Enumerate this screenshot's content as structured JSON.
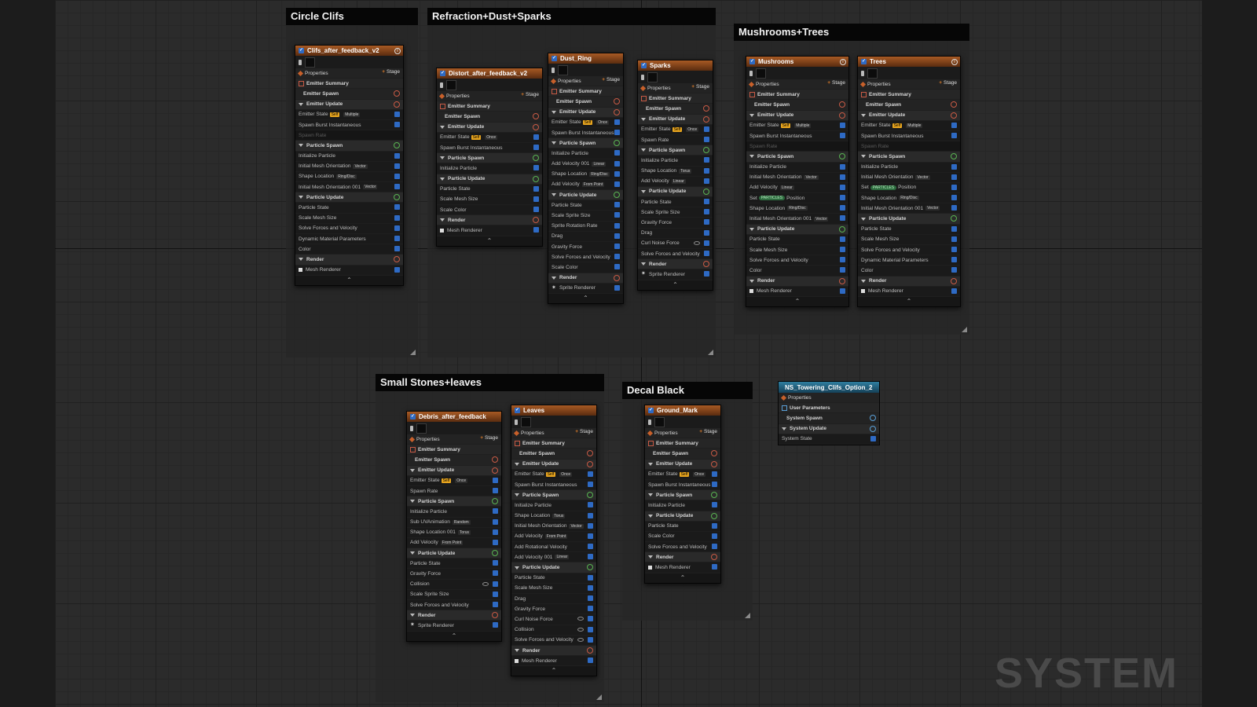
{
  "comments": [
    {
      "id": "c1",
      "title": "Circle Clifs"
    },
    {
      "id": "c2",
      "title": "Refraction+Dust+Sparks"
    },
    {
      "id": "c3",
      "title": "Mushrooms+Trees"
    },
    {
      "id": "c4",
      "title": "Small Stones+leaves"
    },
    {
      "id": "c5",
      "title": "Decal Black"
    }
  ],
  "emitters": [
    {
      "id": "clifs",
      "title": "Clifs_after_feedback_v2",
      "info": true,
      "rows": [
        [
          "props",
          "Properties",
          "Stage"
        ],
        [
          "summary",
          "Emitter Summary"
        ],
        [
          "spawnhdr",
          "Emitter Spawn",
          "plus"
        ],
        [
          "group",
          "Emitter Update",
          "plus"
        ],
        [
          "mod",
          "Emitter State",
          "check",
          "Self",
          "Multiple"
        ],
        [
          "mod",
          "Spawn Burst Instantaneous",
          "check"
        ],
        [
          "dim",
          "Spawn Rate"
        ],
        [
          "group",
          "Particle Spawn",
          "plusg"
        ],
        [
          "mod",
          "Initialize Particle",
          "check"
        ],
        [
          "mod",
          "Initial Mesh Orientation",
          "check",
          "",
          "Vector"
        ],
        [
          "mod",
          "Shape Location",
          "check",
          "",
          "Ring/Disc"
        ],
        [
          "mod",
          "Initial Mesh Orientation 001",
          "check",
          "",
          "Vector"
        ],
        [
          "group",
          "Particle Update",
          "plusg"
        ],
        [
          "mod",
          "Particle State",
          "check"
        ],
        [
          "mod",
          "Scale Mesh Size",
          "check"
        ],
        [
          "mod",
          "Solve Forces and Velocity",
          "check"
        ],
        [
          "mod",
          "Dynamic Material Parameters",
          "check"
        ],
        [
          "mod",
          "Color",
          "check"
        ],
        [
          "group",
          "Render",
          "plus"
        ],
        [
          "mesh",
          "Mesh Renderer",
          "check"
        ]
      ]
    },
    {
      "id": "distort",
      "title": "Distort_after_feedback_v2",
      "rows": [
        [
          "props",
          "Properties",
          "Stage"
        ],
        [
          "summary",
          "Emitter Summary"
        ],
        [
          "spawnhdr",
          "Emitter Spawn",
          "plus"
        ],
        [
          "group",
          "Emitter Update",
          "plus"
        ],
        [
          "mod",
          "Emitter State",
          "check",
          "Self",
          "Once"
        ],
        [
          "mod",
          "Spawn Burst Instantaneous",
          "check"
        ],
        [
          "group",
          "Particle Spawn",
          "plusg"
        ],
        [
          "mod",
          "Initialize Particle",
          "check"
        ],
        [
          "group",
          "Particle Update",
          "plusg"
        ],
        [
          "mod",
          "Particle State",
          "check"
        ],
        [
          "mod",
          "Scale Mesh Size",
          "check"
        ],
        [
          "mod",
          "Scale Color",
          "check"
        ],
        [
          "group",
          "Render",
          "plus"
        ],
        [
          "mesh",
          "Mesh Renderer",
          "check"
        ]
      ]
    },
    {
      "id": "dustring",
      "title": "Dust_Ring",
      "rows": [
        [
          "props",
          "Properties",
          "Stage"
        ],
        [
          "summary",
          "Emitter Summary"
        ],
        [
          "spawnhdr",
          "Emitter Spawn",
          "plus"
        ],
        [
          "group",
          "Emitter Update",
          "plus"
        ],
        [
          "mod",
          "Emitter State",
          "check",
          "Self",
          "Once"
        ],
        [
          "mod",
          "Spawn Burst Instantaneous",
          "check"
        ],
        [
          "group",
          "Particle Spawn",
          "plusg"
        ],
        [
          "mod",
          "Initialize Particle",
          "check"
        ],
        [
          "mod",
          "Add Velocity 001",
          "check",
          "",
          "Linear"
        ],
        [
          "mod",
          "Shape Location",
          "check",
          "",
          "Ring/Disc"
        ],
        [
          "mod",
          "Add Velocity",
          "check",
          "",
          "From Point"
        ],
        [
          "group",
          "Particle Update",
          "plusg"
        ],
        [
          "mod",
          "Particle State",
          "check"
        ],
        [
          "mod",
          "Scale Sprite Size",
          "check"
        ],
        [
          "mod",
          "Sprite Rotation Rate",
          "check"
        ],
        [
          "mod",
          "Drag",
          "check"
        ],
        [
          "mod",
          "Gravity Force",
          "check"
        ],
        [
          "mod",
          "Solve Forces and Velocity",
          "check"
        ],
        [
          "mod",
          "Scale Color",
          "check"
        ],
        [
          "group",
          "Render",
          "plus"
        ],
        [
          "sprite",
          "Sprite Renderer",
          "check"
        ]
      ]
    },
    {
      "id": "sparks",
      "title": "Sparks",
      "rows": [
        [
          "props",
          "Properties",
          "Stage"
        ],
        [
          "summary",
          "Emitter Summary"
        ],
        [
          "spawnhdr",
          "Emitter Spawn",
          "plus"
        ],
        [
          "group",
          "Emitter Update",
          "plus"
        ],
        [
          "mod",
          "Emitter State",
          "check",
          "Self",
          "Once"
        ],
        [
          "mod",
          "Spawn Rate",
          "check"
        ],
        [
          "group",
          "Particle Spawn",
          "plusg"
        ],
        [
          "mod",
          "Initialize Particle",
          "check"
        ],
        [
          "mod",
          "Shape Location",
          "check",
          "",
          "Torus"
        ],
        [
          "mod",
          "Add Velocity",
          "check",
          "",
          "Linear"
        ],
        [
          "group",
          "Particle Update",
          "plusg"
        ],
        [
          "mod",
          "Particle State",
          "check"
        ],
        [
          "mod",
          "Scale Sprite Size",
          "check"
        ],
        [
          "mod",
          "Gravity Force",
          "check"
        ],
        [
          "mod",
          "Drag",
          "check"
        ],
        [
          "modeye",
          "Curl Noise Force",
          "check"
        ],
        [
          "mod",
          "Solve Forces and Velocity",
          "check"
        ],
        [
          "group",
          "Render",
          "plus"
        ],
        [
          "sprite",
          "Sprite Renderer",
          "check"
        ]
      ]
    },
    {
      "id": "mushrooms",
      "title": "Mushrooms",
      "info": true,
      "rows": [
        [
          "props",
          "Properties",
          "Stage"
        ],
        [
          "summary",
          "Emitter Summary"
        ],
        [
          "spawnhdr",
          "Emitter Spawn",
          "plus"
        ],
        [
          "group",
          "Emitter Update",
          "plus"
        ],
        [
          "mod",
          "Emitter State",
          "check",
          "Self",
          "Multiple"
        ],
        [
          "mod",
          "Spawn Burst Instantaneous",
          "check"
        ],
        [
          "dim",
          "Spawn Rate"
        ],
        [
          "group",
          "Particle Spawn",
          "plusg"
        ],
        [
          "mod",
          "Initialize Particle",
          "check"
        ],
        [
          "mod",
          "Initial Mesh Orientation",
          "check",
          "",
          "Vector"
        ],
        [
          "mod",
          "Add Velocity",
          "check",
          "",
          "Linear"
        ],
        [
          "modpill",
          "Set",
          "check",
          "PARTICLES",
          "Position"
        ],
        [
          "mod",
          "Shape Location",
          "check",
          "",
          "Ring/Disc"
        ],
        [
          "mod",
          "Initial Mesh Orientation 001",
          "check",
          "",
          "Vector"
        ],
        [
          "group",
          "Particle Update",
          "plusg"
        ],
        [
          "mod",
          "Particle State",
          "check"
        ],
        [
          "mod",
          "Scale Mesh Size",
          "check"
        ],
        [
          "mod",
          "Solve Forces and Velocity",
          "check"
        ],
        [
          "mod",
          "Color",
          "check"
        ],
        [
          "group",
          "Render",
          "plus"
        ],
        [
          "mesh",
          "Mesh Renderer",
          "check"
        ]
      ]
    },
    {
      "id": "trees",
      "title": "Trees",
      "info": true,
      "rows": [
        [
          "props",
          "Properties",
          "Stage"
        ],
        [
          "summary",
          "Emitter Summary"
        ],
        [
          "spawnhdr",
          "Emitter Spawn",
          "plus"
        ],
        [
          "group",
          "Emitter Update",
          "plus"
        ],
        [
          "mod",
          "Emitter State",
          "check",
          "Self",
          "Multiple"
        ],
        [
          "mod",
          "Spawn Burst Instantaneous",
          "check"
        ],
        [
          "dim",
          "Spawn Rate"
        ],
        [
          "group",
          "Particle Spawn",
          "plusg"
        ],
        [
          "mod",
          "Initialize Particle",
          "check"
        ],
        [
          "mod",
          "Initial Mesh Orientation",
          "check",
          "",
          "Vector"
        ],
        [
          "modpill",
          "Set",
          "check",
          "PARTICLES",
          "Position"
        ],
        [
          "mod",
          "Shape Location",
          "check",
          "",
          "Ring/Disc"
        ],
        [
          "mod",
          "Initial Mesh Orientation 001",
          "check",
          "",
          "Vector"
        ],
        [
          "group",
          "Particle Update",
          "plusg"
        ],
        [
          "mod",
          "Particle State",
          "check"
        ],
        [
          "mod",
          "Scale Mesh Size",
          "check"
        ],
        [
          "mod",
          "Solve Forces and Velocity",
          "check"
        ],
        [
          "mod",
          "Dynamic Material Parameters",
          "check"
        ],
        [
          "mod",
          "Color",
          "check"
        ],
        [
          "group",
          "Render",
          "plus"
        ],
        [
          "mesh",
          "Mesh Renderer",
          "check"
        ]
      ]
    },
    {
      "id": "debris",
      "title": "Debris_after_feedback",
      "rows": [
        [
          "props",
          "Properties",
          "Stage"
        ],
        [
          "summary",
          "Emitter Summary"
        ],
        [
          "spawnhdr",
          "Emitter Spawn",
          "plus"
        ],
        [
          "group",
          "Emitter Update",
          "plus"
        ],
        [
          "mod",
          "Emitter State",
          "check",
          "Self",
          "Once"
        ],
        [
          "mod",
          "Spawn Rate",
          "check"
        ],
        [
          "group",
          "Particle Spawn",
          "plusg"
        ],
        [
          "mod",
          "Initialize Particle",
          "check"
        ],
        [
          "mod",
          "Sub UVAnimation",
          "check",
          "",
          "Random"
        ],
        [
          "mod",
          "Shape Location 001",
          "check",
          "",
          "Torus"
        ],
        [
          "mod",
          "Add Velocity",
          "check",
          "",
          "From Point"
        ],
        [
          "group",
          "Particle Update",
          "plusg"
        ],
        [
          "mod",
          "Particle State",
          "check"
        ],
        [
          "mod",
          "Gravity Force",
          "check"
        ],
        [
          "modeye",
          "Collision",
          "check"
        ],
        [
          "mod",
          "Scale Sprite Size",
          "check"
        ],
        [
          "mod",
          "Solve Forces and Velocity",
          "check"
        ],
        [
          "group",
          "Render",
          "plus"
        ],
        [
          "sprite",
          "Sprite Renderer",
          "check"
        ]
      ]
    },
    {
      "id": "leaves",
      "title": "Leaves",
      "rows": [
        [
          "props",
          "Properties",
          "Stage"
        ],
        [
          "summary",
          "Emitter Summary"
        ],
        [
          "spawnhdr",
          "Emitter Spawn",
          "plus"
        ],
        [
          "group",
          "Emitter Update",
          "plus"
        ],
        [
          "mod",
          "Emitter State",
          "check",
          "Self",
          "Once"
        ],
        [
          "mod",
          "Spawn Burst Instantaneous",
          "check"
        ],
        [
          "group",
          "Particle Spawn",
          "plusg"
        ],
        [
          "mod",
          "Initialize Particle",
          "check"
        ],
        [
          "mod",
          "Shape Location",
          "check",
          "",
          "Torus"
        ],
        [
          "mod",
          "Initial Mesh Orientation",
          "check",
          "",
          "Vector"
        ],
        [
          "mod",
          "Add Velocity",
          "check",
          "",
          "From Point"
        ],
        [
          "mod",
          "Add Rotational Velocity",
          "check"
        ],
        [
          "mod",
          "Add Velocity 001",
          "check",
          "",
          "Linear"
        ],
        [
          "group",
          "Particle Update",
          "plusg"
        ],
        [
          "mod",
          "Particle State",
          "check"
        ],
        [
          "mod",
          "Scale Mesh Size",
          "check"
        ],
        [
          "mod",
          "Drag",
          "check"
        ],
        [
          "mod",
          "Gravity Force",
          "check"
        ],
        [
          "modeye",
          "Curl Noise Force",
          "check"
        ],
        [
          "modeye",
          "Collision",
          "check"
        ],
        [
          "modeye",
          "Solve Forces and Velocity",
          "check"
        ],
        [
          "group",
          "Render",
          "plus"
        ],
        [
          "mesh",
          "Mesh Renderer",
          "check"
        ]
      ]
    },
    {
      "id": "groundmark",
      "title": "Ground_Mark",
      "rows": [
        [
          "props",
          "Properties",
          "Stage"
        ],
        [
          "summary",
          "Emitter Summary"
        ],
        [
          "spawnhdr",
          "Emitter Spawn",
          "plus"
        ],
        [
          "group",
          "Emitter Update",
          "plus"
        ],
        [
          "mod",
          "Emitter State",
          "check",
          "Self",
          "Once"
        ],
        [
          "mod",
          "Spawn Burst Instantaneous",
          "check"
        ],
        [
          "group",
          "Particle Spawn",
          "plusg"
        ],
        [
          "mod",
          "Initialize Particle",
          "check"
        ],
        [
          "group",
          "Particle Update",
          "plusg"
        ],
        [
          "mod",
          "Particle State",
          "check"
        ],
        [
          "mod",
          "Scale Color",
          "check"
        ],
        [
          "mod",
          "Solve Forces and Velocity",
          "check"
        ],
        [
          "group",
          "Render",
          "plus"
        ],
        [
          "mesh",
          "Mesh Renderer",
          "check"
        ]
      ]
    }
  ],
  "system_node": {
    "title": "NS_Towering_Clifs_Option_2",
    "rows": [
      [
        "props",
        "Properties"
      ],
      [
        "user",
        "User Parameters"
      ],
      [
        "spawnhdr",
        "System Spawn",
        "plusblue"
      ],
      [
        "group",
        "System Update",
        "plusblue"
      ],
      [
        "mod",
        "System State",
        "check"
      ]
    ]
  },
  "watermark": "SYSTEM",
  "colors": {
    "emitter_header": "#a85a24",
    "system_header": "#2f7ea0",
    "checkbox": "#2e6ac4",
    "canvas": "#2b2b2b"
  }
}
